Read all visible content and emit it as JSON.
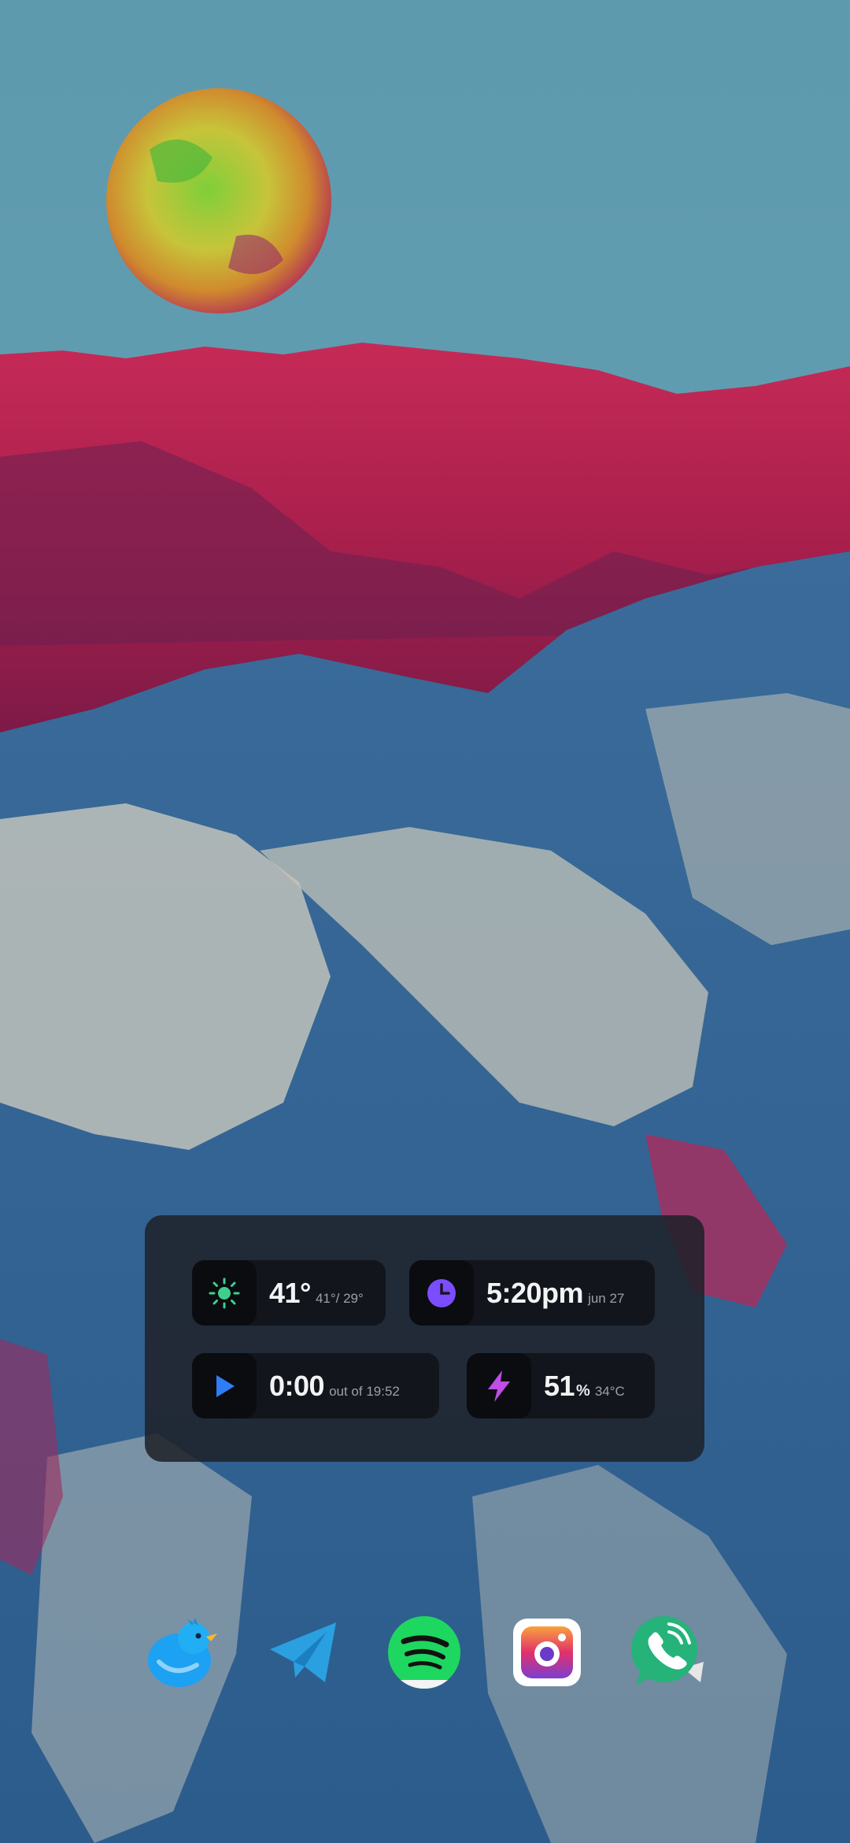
{
  "widgets": {
    "weather": {
      "icon": "sun-icon",
      "temp": "41°",
      "range": "41°/ 29°",
      "accent": "#3ecf8e"
    },
    "clock": {
      "icon": "clock-icon",
      "time": "5:20pm",
      "date": "jun 27",
      "accent": "#7c4dff"
    },
    "media": {
      "icon": "play-icon",
      "position": "0:00",
      "duration": "out of 19:52",
      "accent": "#2f7df6"
    },
    "battery": {
      "icon": "bolt-icon",
      "level": "51",
      "unit": "%",
      "temperature": "34°C",
      "accent": "#c04de6"
    }
  },
  "dock": {
    "apps": [
      {
        "name": "Twitter",
        "icon": "twitter-bird-icon",
        "color": "#1da1f2"
      },
      {
        "name": "Telegram",
        "icon": "telegram-plane-icon",
        "color": "#2aa0e0"
      },
      {
        "name": "Spotify",
        "icon": "spotify-icon",
        "color": "#1ed760"
      },
      {
        "name": "Instagram",
        "icon": "instagram-camera-icon",
        "color": "#e1306c"
      },
      {
        "name": "WhatsApp",
        "icon": "whatsapp-phone-icon",
        "color": "#25d366"
      }
    ]
  }
}
